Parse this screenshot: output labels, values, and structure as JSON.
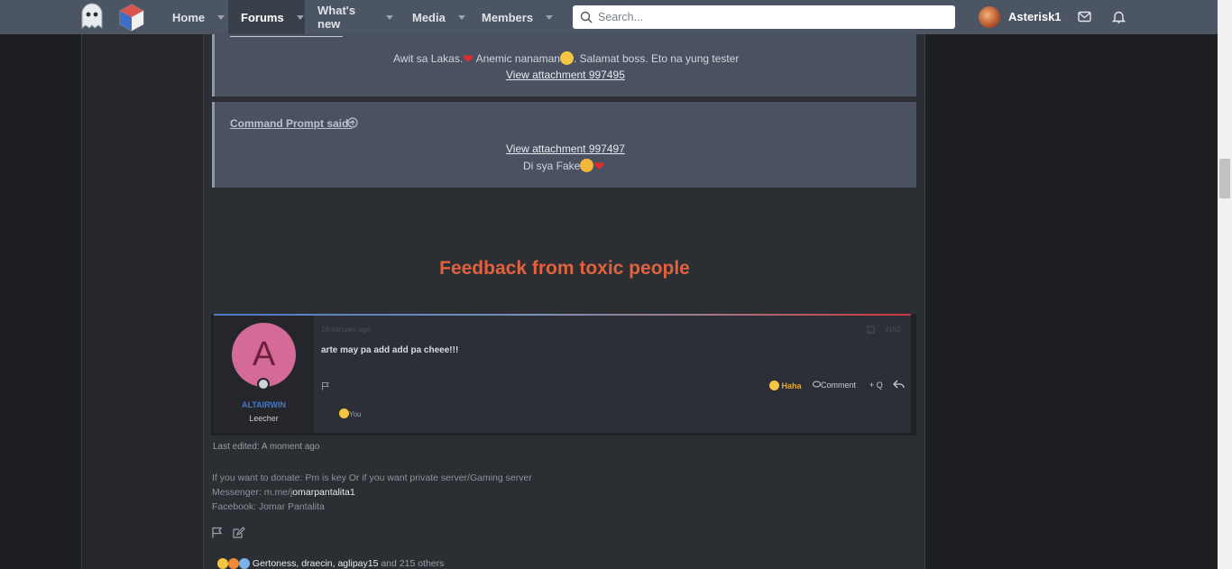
{
  "nav": {
    "items": [
      {
        "label": "Home"
      },
      {
        "label": "Forums"
      },
      {
        "label": "What's new"
      },
      {
        "label": "Media"
      },
      {
        "label": "Members"
      }
    ],
    "search_placeholder": "Search...",
    "username": "Asterisk1"
  },
  "quote1": {
    "text_a": "Awit sa Lakas.",
    "text_b": " Anemic nanaman",
    "text_c": ". Salamat boss. Eto na yung tester",
    "attachment": "View attachment 997495"
  },
  "quote2": {
    "author": "Command Prompt said:",
    "attachment": "View attachment 997497",
    "text": "Di sya Fake"
  },
  "heading": "Feedback from toxic people",
  "embedded": {
    "avatar_letter": "A",
    "name": "ALTAIRWIN",
    "role": "Leecher",
    "time": "18 minutes ago",
    "post_num": "#152",
    "message": "arte may pa add add pa cheee!!!",
    "reaction_label": "Haha",
    "comment_label": "Comment",
    "quote_label": "+ Q",
    "you_label": "You"
  },
  "post": {
    "last_edited": "Last edited: A moment ago",
    "sig_line1": "If you want to donate: Pm is key Or if you want private server/Gaming server",
    "sig_line2_prefix": "Messenger: m.me/j",
    "sig_line2_link": "omarpantalita1",
    "sig_line3": "Facebook: Jomar Pantalita",
    "reactions_names": "Gertoness, draecin, aglipay15",
    "reactions_others": " and 215 others"
  }
}
